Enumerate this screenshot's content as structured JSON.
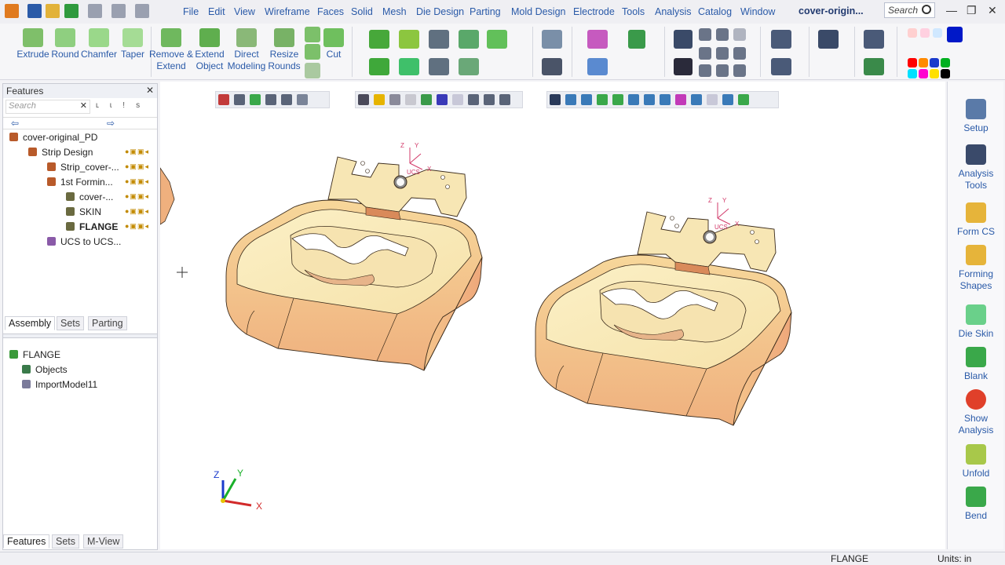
{
  "menu": [
    "File",
    "Edit",
    "View",
    "Wireframe",
    "Faces",
    "Solid",
    "Mesh",
    "Die Design",
    "Parting",
    "Mold Design",
    "Electrode",
    "Tools",
    "Analysis",
    "Catalog",
    "Window"
  ],
  "doc_title": "cover-origin...",
  "search_placeholder": "Search",
  "ribbon": {
    "extrude": "Extrude",
    "round": "Round",
    "chamfer": "Chamfer",
    "taper": "Taper",
    "remove_extend": "Remove &\nExtend",
    "extend_object": "Extend\nObject",
    "direct_modeling": "Direct\nModeling",
    "resize_rounds": "Resize\nRounds",
    "cut": "Cut"
  },
  "features_panel": {
    "title": "Features",
    "search": "Search",
    "search_tools": [
      "ʟ",
      "ɩ",
      "!",
      "s"
    ],
    "tree": [
      {
        "label": "cover-original_PD"
      },
      {
        "label": "Strip Design"
      },
      {
        "label": "Strip_cover-..."
      },
      {
        "label": "1st Formin..."
      },
      {
        "label": "cover-..."
      },
      {
        "label": "SKIN"
      },
      {
        "label": "FLANGE"
      },
      {
        "label": "UCS to UCS..."
      }
    ],
    "tabs": [
      "Assembly",
      "Sets",
      "Parting"
    ]
  },
  "lower_panel": {
    "tree": [
      {
        "label": "FLANGE"
      },
      {
        "label": "Objects"
      },
      {
        "label": "ImportModel11"
      }
    ],
    "tabs": [
      "Features",
      "Sets",
      "M-View"
    ]
  },
  "right_panel": [
    {
      "label": "Setup",
      "icon": "setup-icon"
    },
    {
      "label": "Analysis\nTools",
      "icon": "analysis-tools-icon"
    },
    {
      "label": "Form CS",
      "icon": "form-cs-icon"
    },
    {
      "label": "Forming\nShapes",
      "icon": "forming-shapes-icon"
    },
    {
      "label": "Die Skin",
      "icon": "die-skin-icon"
    },
    {
      "label": "Blank",
      "icon": "blank-icon"
    },
    {
      "label": "Show\nAnalysis",
      "icon": "show-analysis-icon"
    },
    {
      "label": "Unfold",
      "icon": "unfold-icon"
    },
    {
      "label": "Bend",
      "icon": "bend-icon"
    }
  ],
  "viewport": {
    "triad": {
      "z": "Z",
      "y": "Y",
      "x": "X"
    },
    "part_ucs": {
      "z": "Z",
      "y": "Y",
      "x": "X",
      "name": "UCS"
    }
  },
  "status": {
    "object": "FLANGE",
    "units": "Units: in"
  },
  "colors": {
    "accent": "#2a5aa8",
    "part_face": "#f7e8b6",
    "part_shade": "#f0b88c",
    "part_edge": "#3a2a1a",
    "ucs": "#d23a6a"
  }
}
